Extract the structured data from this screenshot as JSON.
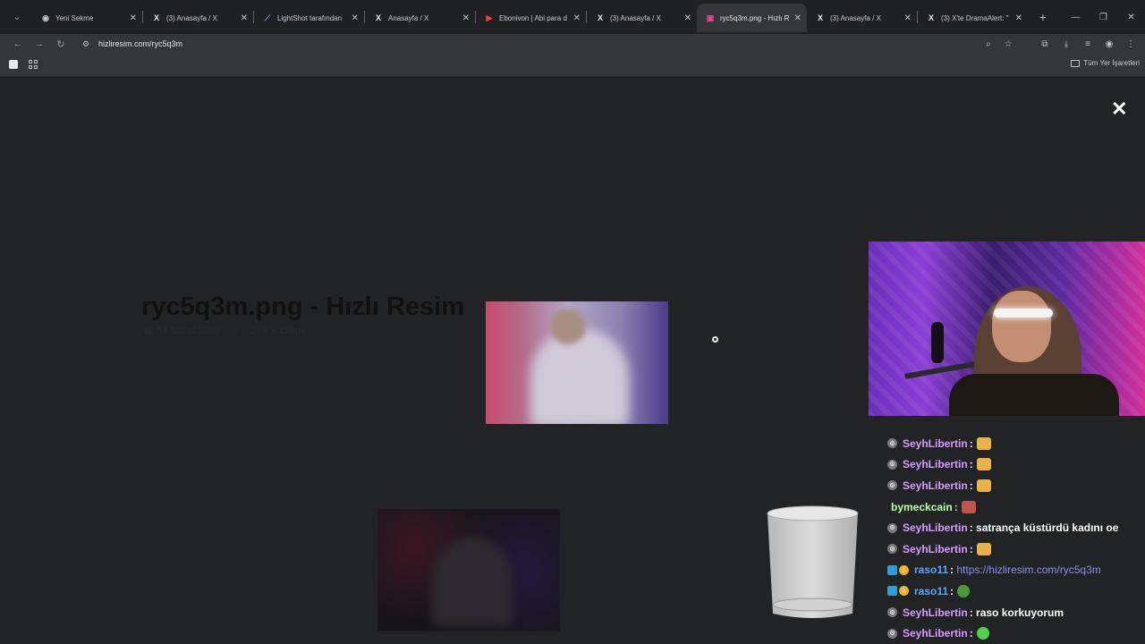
{
  "browser": {
    "tabs": [
      {
        "title": "Yeni Sekme",
        "icon": "chrome-icon",
        "active": false
      },
      {
        "title": "(3) Anasayfa / X",
        "icon": "x-icon",
        "active": false
      },
      {
        "title": "LightShot tarafından",
        "icon": "feather-icon",
        "active": false
      },
      {
        "title": "Anasayfa / X",
        "icon": "x-icon",
        "active": false
      },
      {
        "title": "Ebonivon | Abi para d",
        "icon": "youtube-icon",
        "active": false
      },
      {
        "title": "(3) Anasayfa / X",
        "icon": "x-icon",
        "active": false
      },
      {
        "title": "ryc5q3m.png - Hızlı R",
        "icon": "hizliresim-icon",
        "active": true
      },
      {
        "title": "(3) Anasayfa / X",
        "icon": "x-icon",
        "active": false
      },
      {
        "title": "(3) X'te DramaAlert: \"",
        "icon": "x-icon",
        "active": false
      }
    ],
    "url": "hizliresim.com/ryc5q3m",
    "bookmarks_all": "Tüm Yer İşaretleri"
  },
  "page": {
    "title": "ryc5q3m.png - Hızlı Resim",
    "date": "04 Nisan 2026",
    "dimensions": "279 × 189px",
    "close_glyph": "✕"
  },
  "chat": [
    {
      "user": "SeyhLibertin",
      "user_color": "#d59cff",
      "sep": " :",
      "text": "",
      "emote": "laugh",
      "badges": [
        "gear"
      ]
    },
    {
      "user": "SeyhLibertin",
      "user_color": "#d59cff",
      "sep": " :",
      "text": "",
      "emote": "laugh",
      "badges": [
        "gear"
      ]
    },
    {
      "user": "SeyhLibertin",
      "user_color": "#d59cff",
      "sep": " :",
      "text": "",
      "emote": "laugh",
      "badges": [
        "gear"
      ]
    },
    {
      "user": "bymeckcain",
      "user_color": "#b8ffb0",
      "sep": " :",
      "text": "",
      "emote": "face",
      "badges": []
    },
    {
      "user": "SeyhLibertin",
      "user_color": "#d59cff",
      "sep": " :",
      "text": " satrança küstürdü kadını oe",
      "emote": "",
      "badges": [
        "gear"
      ]
    },
    {
      "user": "SeyhLibertin",
      "user_color": "#d59cff",
      "sep": " :",
      "text": "",
      "emote": "laugh",
      "badges": [
        "gear"
      ]
    },
    {
      "user": "raso11",
      "user_color": "#5aa9ff",
      "sep": " :",
      "text": "",
      "link": " https://hizliresim.com/ryc5q3m",
      "emote": "",
      "badges": [
        "cube",
        "coin"
      ]
    },
    {
      "user": "raso11",
      "user_color": "#5aa9ff",
      "sep": " :",
      "text": "",
      "emote": "globe",
      "badges": [
        "cube",
        "coin"
      ]
    },
    {
      "user": "SeyhLibertin",
      "user_color": "#d59cff",
      "sep": " :",
      "text": " raso korkuyorum",
      "emote": "",
      "badges": [
        "gear"
      ]
    },
    {
      "user": "SeyhLibertin",
      "user_color": "#d59cff",
      "sep": " :",
      "text": "",
      "emote": "green",
      "badges": [
        "gear"
      ]
    }
  ]
}
